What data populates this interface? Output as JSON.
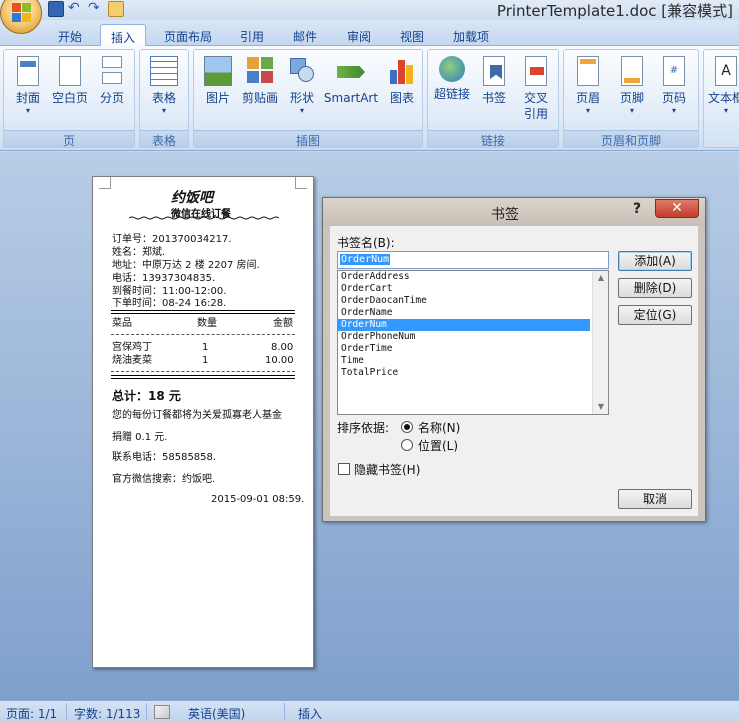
{
  "window": {
    "title": "PrinterTemplate1.doc [兼容模式]"
  },
  "quick_access": {
    "icons": [
      "save-icon",
      "undo-icon",
      "redo-icon",
      "open-icon"
    ]
  },
  "tabs": [
    "开始",
    "插入",
    "页面布局",
    "引用",
    "邮件",
    "审阅",
    "视图",
    "加载项"
  ],
  "active_tab": "插入",
  "ribbon": {
    "groups": {
      "pages": {
        "label": "页",
        "buttons": [
          "封面",
          "空白页",
          "分页"
        ]
      },
      "tables": {
        "label": "表格",
        "buttons": [
          "表格"
        ]
      },
      "illustrations": {
        "label": "插图",
        "buttons": [
          "图片",
          "剪贴画",
          "形状",
          "SmartArt",
          "图表"
        ]
      },
      "links": {
        "label": "链接",
        "buttons": [
          "超链接",
          "书签",
          "交叉",
          "引用"
        ]
      },
      "header_footer": {
        "label": "页眉和页脚",
        "buttons": [
          "页眉",
          "页脚",
          "页码"
        ]
      },
      "text": {
        "buttons": [
          "文本框"
        ]
      }
    }
  },
  "document": {
    "title": "约饭吧",
    "subtitle": "微信在线订餐",
    "info_lines": [
      "订单号：201370034217.",
      "姓名：郑斌.",
      "地址：中原万达 2 楼 2207 房间.",
      "电话：13937304835.",
      "到餐时间：11:00-12:00.",
      "下单时间：08-24 16:28."
    ],
    "table_headers": [
      "菜品",
      "数量",
      "金额"
    ],
    "table_rows": [
      {
        "name": "宫保鸡丁",
        "qty": "1",
        "amount": "8.00"
      },
      {
        "name": "烧油麦菜",
        "qty": "1",
        "amount": "10.00"
      }
    ],
    "total": "总计：18 元",
    "notes": [
      "您的每份订餐都将为关爱孤寡老人基金",
      "捐赠 0.1 元.",
      "联系电话：58585858.",
      "官方微信搜索：约饭吧."
    ],
    "datetime": "2015-09-01 08:59."
  },
  "dialog": {
    "title": "书签",
    "help": "?",
    "close": "✕",
    "name_label": "书签名(B):",
    "name_value": "OrderNum",
    "bookmarks": [
      "OrderAddress",
      "OrderCart",
      "OrderDaocanTime",
      "OrderName",
      "OrderNum",
      "OrderPhoneNum",
      "OrderTime",
      "Time",
      "TotalPrice"
    ],
    "selected_bookmark": "OrderNum",
    "buttons": {
      "add": "添加(A)",
      "delete": "删除(D)",
      "goto": "定位(G)",
      "cancel": "取消"
    },
    "sort_label": "排序依据:",
    "sort_options": [
      "名称(N)",
      "位置(L)"
    ],
    "sort_selected": "名称(N)",
    "hidden_label": "隐藏书签(H)"
  },
  "statusbar": {
    "page": "页面: 1/1",
    "words": "字数: 1/113",
    "language": "英语(美国)",
    "mode": "插入"
  },
  "colors": {
    "ribbon_text": "#15428b",
    "selection": "#3399ff",
    "close_button": "#c23c27"
  }
}
